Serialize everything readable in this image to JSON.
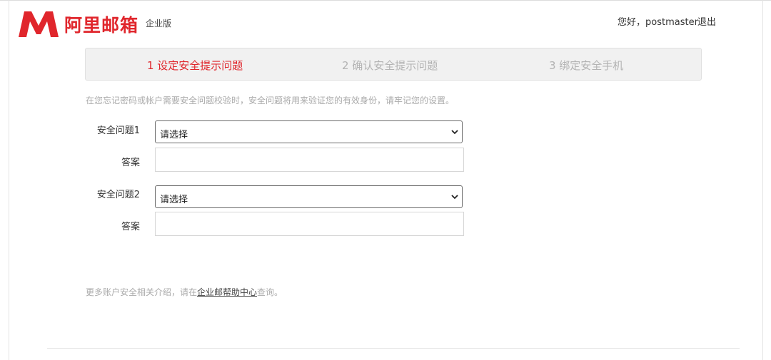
{
  "brand": {
    "name": "阿里邮箱",
    "edition": "企业版",
    "color": "#e0262c"
  },
  "user": {
    "greeting": "您好，postmaster",
    "logout_label": "退出"
  },
  "steps": [
    {
      "label": "1 设定安全提示问题",
      "active": true
    },
    {
      "label": "2 确认安全提示问题",
      "active": false
    },
    {
      "label": "3 绑定安全手机",
      "active": false
    }
  ],
  "intro": "在您忘记密码或帐户需要安全问题校验时，安全问题将用来验证您的有效身份，请牢记您的设置。",
  "questions": [
    {
      "label": "安全问题1",
      "selected": "请选择",
      "answer_label": "答案",
      "answer_value": ""
    },
    {
      "label": "安全问题2",
      "selected": "请选择",
      "answer_label": "答案",
      "answer_value": ""
    }
  ],
  "help": {
    "prefix": "更多账户安全相关介绍，请在",
    "link": "企业邮帮助中心",
    "suffix": "查询。"
  },
  "icons": {
    "logo": "m-logo-icon",
    "chevron": "chevron-down-icon"
  }
}
